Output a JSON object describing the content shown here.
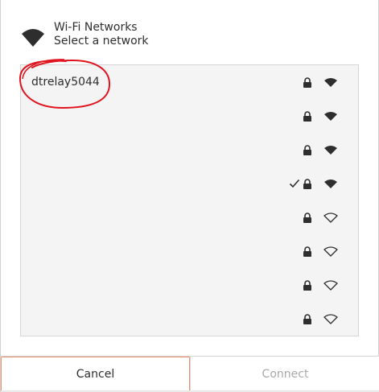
{
  "header": {
    "title": "Wi-Fi Networks",
    "subtitle": "Select a network",
    "icon": "wifi-icon"
  },
  "networks": [
    {
      "name": "dtrelay5044",
      "secured": true,
      "signal": "strong",
      "connected": false
    },
    {
      "name": "",
      "secured": true,
      "signal": "strong",
      "connected": false
    },
    {
      "name": "",
      "secured": true,
      "signal": "strong",
      "connected": false
    },
    {
      "name": "",
      "secured": true,
      "signal": "strong",
      "connected": true
    },
    {
      "name": "",
      "secured": true,
      "signal": "weak",
      "connected": false
    },
    {
      "name": "",
      "secured": true,
      "signal": "weak",
      "connected": false
    },
    {
      "name": "",
      "secured": true,
      "signal": "weak",
      "connected": false
    },
    {
      "name": "",
      "secured": true,
      "signal": "weak",
      "connected": false
    }
  ],
  "footer": {
    "cancel_label": "Cancel",
    "connect_label": "Connect"
  },
  "colors": {
    "annotation": "#e0141e",
    "cancel_border": "#e9906a",
    "disabled_text": "#a8a8a8",
    "icon": "#2e2e2e"
  }
}
